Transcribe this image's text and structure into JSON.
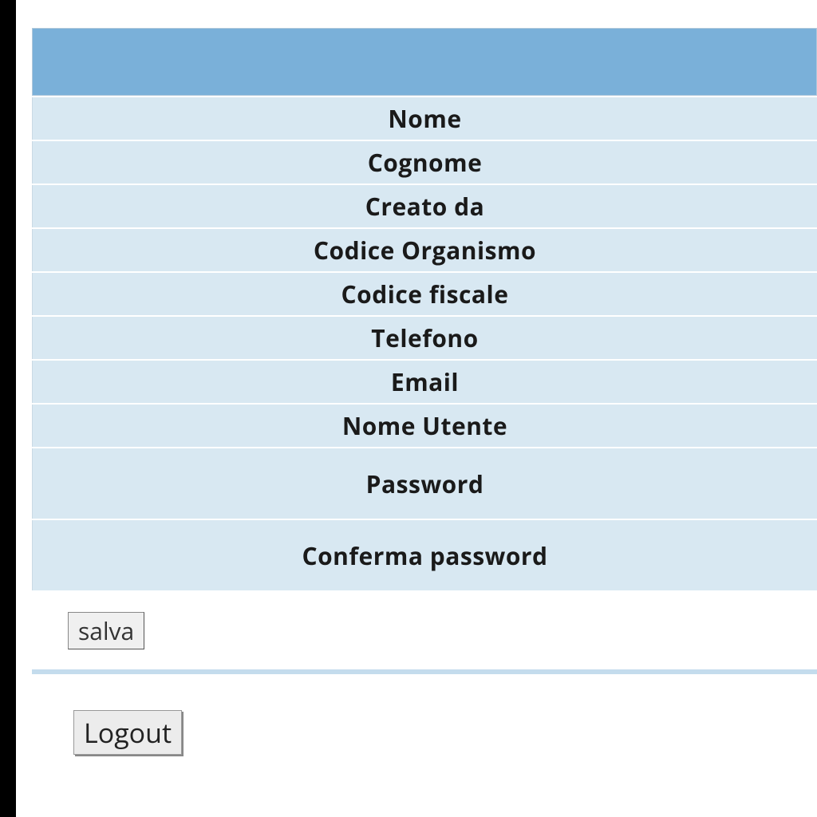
{
  "form": {
    "fields": [
      {
        "label": "Nome"
      },
      {
        "label": "Cognome"
      },
      {
        "label": "Creato da"
      },
      {
        "label": "Codice Organismo"
      },
      {
        "label": "Codice fiscale"
      },
      {
        "label": "Telefono"
      },
      {
        "label": "Email"
      },
      {
        "label": "Nome Utente"
      },
      {
        "label": "Password"
      },
      {
        "label": "Conferma password"
      }
    ],
    "save_label": "salva"
  },
  "auth": {
    "logout_label": "Logout"
  }
}
